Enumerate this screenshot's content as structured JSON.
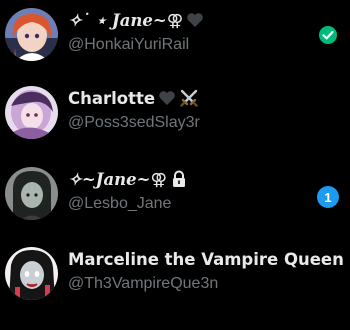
{
  "accounts": [
    {
      "display_name": "✧˙ ⋆ Jane~",
      "name_suffix": "⚢",
      "handle": "@HonkaiYuriRail",
      "status": "active",
      "icons": [
        "black-heart-icon"
      ]
    },
    {
      "display_name": "Charlotte",
      "handle": "@Poss3sedSlay3r",
      "icons": [
        "black-heart-icon",
        "crossed-swords-icon"
      ]
    },
    {
      "display_name": "✧~Jane~",
      "name_suffix": "⚢",
      "handle": "@Lesbo_Jane",
      "icons": [
        "lock-icon"
      ],
      "unread_count": "1"
    },
    {
      "display_name": "Marceline the Vampire Queen",
      "handle": "@Th3VampireQue3n",
      "icons": []
    }
  ],
  "colors": {
    "background": "#000000",
    "name_text": "#e7e9ea",
    "handle_text": "#71767b",
    "active_check": "#00ba7c",
    "badge": "#1d9bf0"
  }
}
